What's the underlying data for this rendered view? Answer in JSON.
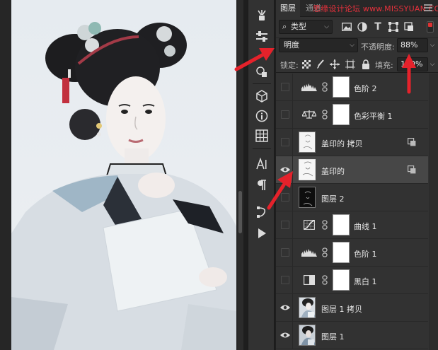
{
  "tabs": [
    {
      "label": "图层",
      "active": true
    },
    {
      "label": "通道",
      "active": false
    }
  ],
  "watermark": "思缘设计论坛 www.MISSYUAN.COM",
  "filter": {
    "kind_label": "类型",
    "icons": [
      "image-filter-icon",
      "adjustment-filter-icon",
      "type-filter-icon",
      "shape-filter-icon",
      "smart-object-filter-icon"
    ]
  },
  "blend_mode": {
    "value": "明度"
  },
  "opacity": {
    "label": "不透明度:",
    "value": "88%"
  },
  "lock": {
    "label": "锁定:"
  },
  "fill": {
    "label": "填充:",
    "value": "100%"
  },
  "layers": [
    {
      "name": "色阶 2",
      "type": "adjustment",
      "icon": "levels-icon",
      "visible": false,
      "selected": false
    },
    {
      "name": "色彩平衡 1",
      "type": "adjustment",
      "icon": "color-balance-icon",
      "visible": false,
      "selected": false
    },
    {
      "name": "盖印的 拷贝",
      "type": "smart",
      "visible": false,
      "selected": false
    },
    {
      "name": "盖印的",
      "type": "smart",
      "visible": true,
      "selected": true
    },
    {
      "name": "图层 2",
      "type": "pixel",
      "visible": false,
      "selected": false
    },
    {
      "name": "曲线 1",
      "type": "adjustment",
      "icon": "curves-icon",
      "visible": false,
      "selected": false
    },
    {
      "name": "色阶 1",
      "type": "adjustment",
      "icon": "levels-icon",
      "visible": false,
      "selected": false
    },
    {
      "name": "黑白 1",
      "type": "adjustment",
      "icon": "black-white-icon",
      "visible": false,
      "selected": false
    },
    {
      "name": "图层 1 拷贝",
      "type": "photo",
      "visible": true,
      "selected": false
    },
    {
      "name": "图层 1",
      "type": "photo",
      "visible": true,
      "selected": false
    }
  ],
  "colors": {
    "panel_bg": "#323232",
    "selected_row": "#474747",
    "annotation_red": "#e5222b"
  }
}
